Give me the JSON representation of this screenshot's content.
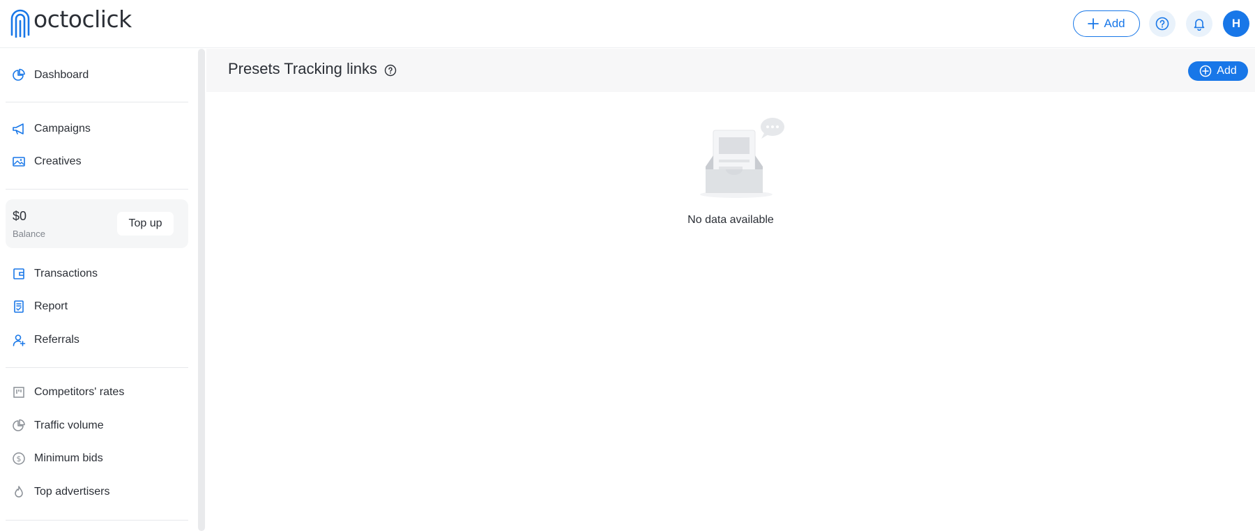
{
  "app": {
    "logo_text": "octoclick",
    "header": {
      "add_label": "Add",
      "avatar_initial": "H"
    }
  },
  "sidebar": {
    "items": [
      {
        "label": "Dashboard",
        "icon": "pie-chart-icon"
      },
      {
        "label": "Campaigns",
        "icon": "megaphone-icon"
      },
      {
        "label": "Creatives",
        "icon": "image-icon"
      },
      {
        "label": "Transactions",
        "icon": "wallet-icon"
      },
      {
        "label": "Report",
        "icon": "report-icon"
      },
      {
        "label": "Referrals",
        "icon": "referrals-icon"
      },
      {
        "label": "Competitors' rates",
        "icon": "kanban-icon"
      },
      {
        "label": "Traffic volume",
        "icon": "pie-chart-icon"
      },
      {
        "label": "Minimum bids",
        "icon": "dollar-circle-icon"
      },
      {
        "label": "Top advertisers",
        "icon": "flame-icon"
      }
    ],
    "balance": {
      "amount": "$0",
      "label": "Balance",
      "topup_label": "Top up"
    }
  },
  "main": {
    "title": "Presets Tracking links",
    "add_label": "Add",
    "empty_text": "No data available"
  },
  "colors": {
    "accent": "#1877e8",
    "icon_active": "#1877e8",
    "icon_muted": "#8a8f96"
  }
}
